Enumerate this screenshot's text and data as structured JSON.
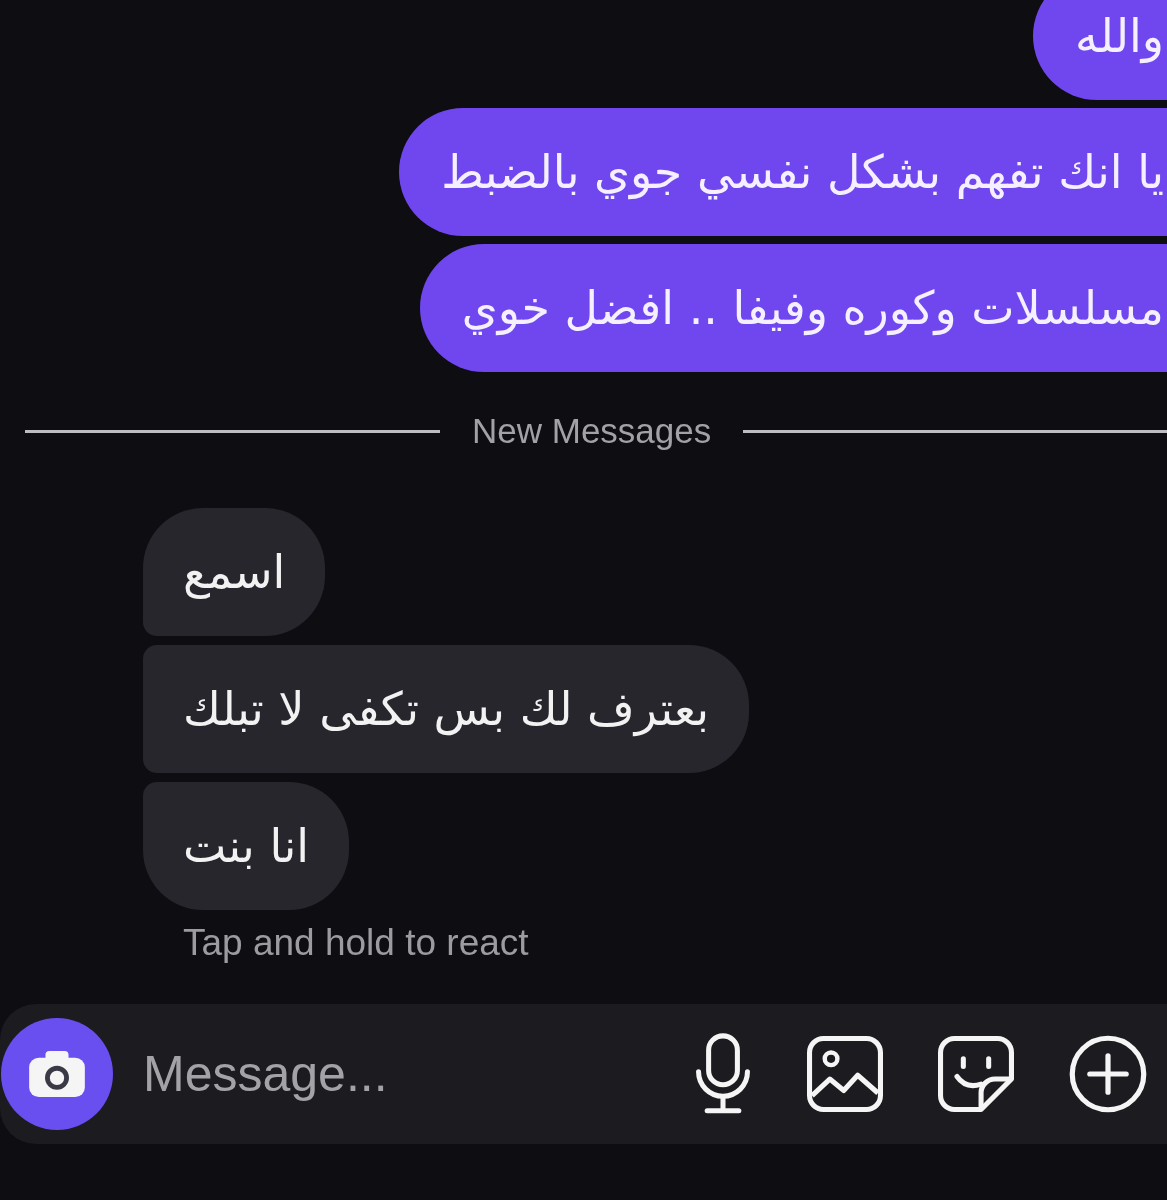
{
  "thread": [
    {
      "kind": "sent",
      "text": "والله"
    },
    {
      "kind": "sent",
      "text": "يا انك تفهم بشكل نفسي جوي بالضبط"
    },
    {
      "kind": "sent",
      "text": "مسلسلات وكوره وفيفا .. افضل خوي"
    },
    {
      "kind": "divider",
      "text": "New Messages"
    },
    {
      "kind": "received",
      "text": "اسمع"
    },
    {
      "kind": "received",
      "text": "بعترف لك بس تكفى لا تبلك"
    },
    {
      "kind": "received",
      "text": "انا بنت"
    }
  ],
  "react_hint": "Tap and hold to react",
  "composer": {
    "placeholder": "Message..."
  }
}
